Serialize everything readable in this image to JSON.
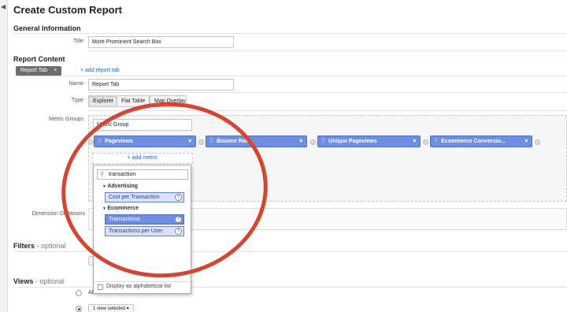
{
  "page": {
    "title": "Create Custom Report"
  },
  "general": {
    "heading": "General Information",
    "title_label": "Title",
    "title_value": "More Prominent Search Box"
  },
  "content": {
    "heading": "Report Content",
    "tab_label": "Report Tab",
    "tab_close": "×",
    "add_tab": "+ add report tab",
    "name_label": "Name",
    "name_value": "Report Tab",
    "type_label": "Type",
    "type_options": [
      "Explorer",
      "Flat Table",
      "Map Overlay"
    ],
    "metric_groups_label": "Metric Groups",
    "metric_group_name": "Metric Group",
    "metrics": [
      "Pageviews",
      "Bounce Rate",
      "Unique Pageviews",
      "Ecommerce Conversio..."
    ],
    "add_metric": "+ add metric",
    "dimension_label": "Dimension Drilldowns"
  },
  "dropdown": {
    "search_value": "transaction",
    "groups": [
      {
        "name": "Advertising",
        "items": [
          "Cost per Transaction"
        ]
      },
      {
        "name": "Ecommerce",
        "items": [
          "Transactions",
          "Transactions per User"
        ]
      }
    ],
    "alpha_checkbox": "Display as alphabetical list",
    "help_glyph": "?"
  },
  "filters": {
    "heading": "Filters",
    "optional": "- optional"
  },
  "views": {
    "heading": "Views",
    "optional": "- optional",
    "all_views": "All views associated with this account",
    "one_view": "1 view selected"
  },
  "colors": {
    "annotation": "#d6452f",
    "chip": "#6f8ee0",
    "link": "#1a62c6"
  },
  "icons": {
    "search": "search-icon",
    "help": "help-icon",
    "caret": "chevron-down-icon",
    "grip": "drag-handle-icon"
  }
}
